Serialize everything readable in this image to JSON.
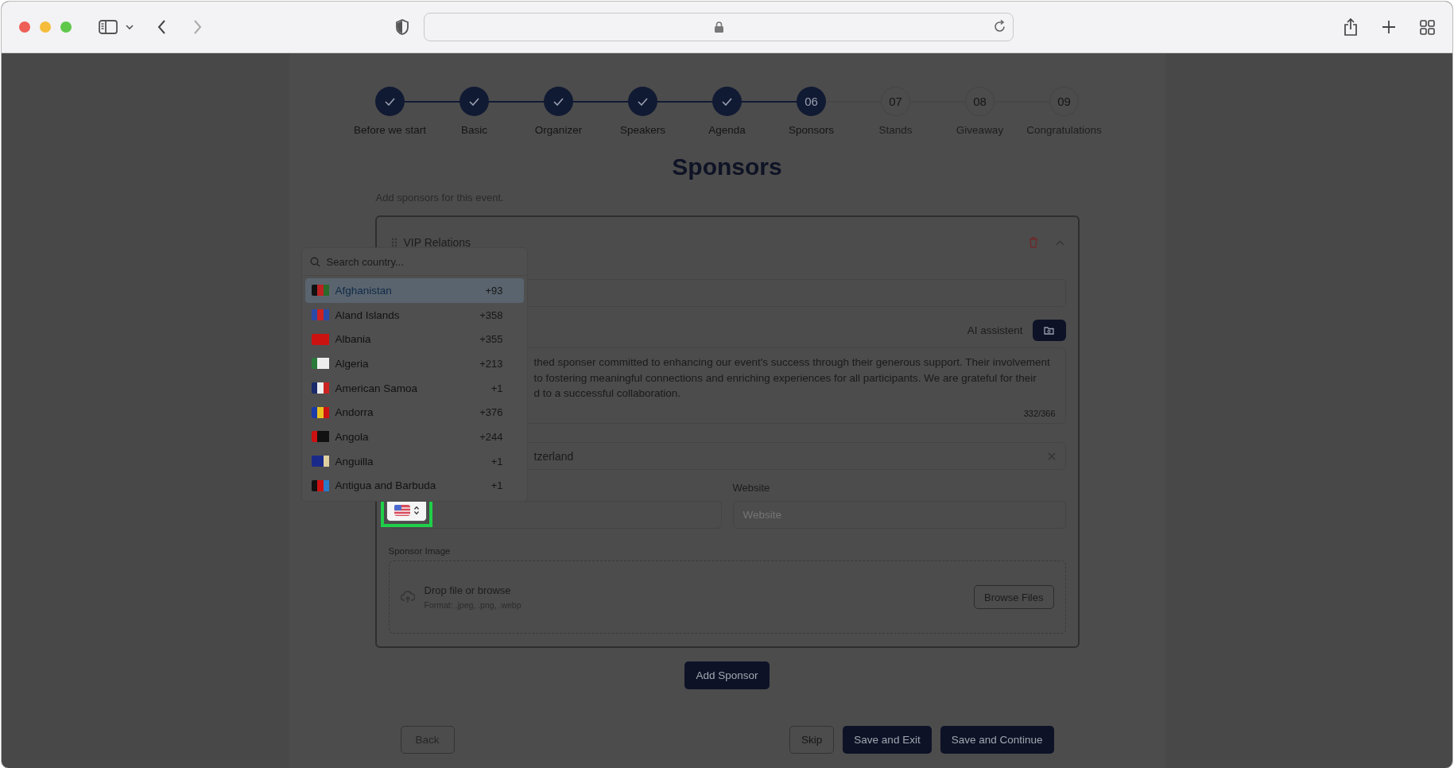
{
  "steps": [
    {
      "label": "Before we start",
      "kind": "done"
    },
    {
      "label": "Basic",
      "kind": "done"
    },
    {
      "label": "Organizer",
      "kind": "done"
    },
    {
      "label": "Speakers",
      "kind": "done"
    },
    {
      "label": "Agenda",
      "kind": "done"
    },
    {
      "label": "Sponsors",
      "number": "06",
      "kind": "current"
    },
    {
      "label": "Stands",
      "number": "07",
      "kind": "upcoming"
    },
    {
      "label": "Giveaway",
      "number": "08",
      "kind": "upcoming"
    },
    {
      "label": "Congratulations",
      "number": "09",
      "kind": "upcoming"
    }
  ],
  "title": "Sponsors",
  "subtitle": "Add sponsors for this event.",
  "sponsor_card": {
    "title": "VIP Relations",
    "ai_label": "AI assistent",
    "description": "thed sponser committed to enhancing our event's success through their generous support. Their involvement\nto fostering meaningful connections and enriching experiences for all participants. We are grateful for their\nd to a successful collaboration.",
    "char_count": "332/366",
    "country_value": "tzerland",
    "website_label": "Website",
    "website_placeholder": "Website",
    "image_label": "Sponsor Image",
    "drop_title": "Drop file or browse",
    "drop_formats": "Format: .jpeg, .png, .webp",
    "browse_button": "Browse Files"
  },
  "country_dropdown": {
    "placeholder": "Search country...",
    "items": [
      {
        "name": "Afghanistan",
        "code": "+93",
        "selected": true
      },
      {
        "name": "Aland Islands",
        "code": "+358",
        "selected": false
      },
      {
        "name": "Albania",
        "code": "+355",
        "selected": false
      },
      {
        "name": "Algeria",
        "code": "+213",
        "selected": false
      },
      {
        "name": "American Samoa",
        "code": "+1",
        "selected": false
      },
      {
        "name": "Andorra",
        "code": "+376",
        "selected": false
      },
      {
        "name": "Angola",
        "code": "+244",
        "selected": false
      },
      {
        "name": "Anguilla",
        "code": "+1",
        "selected": false
      },
      {
        "name": "Antigua and Barbuda",
        "code": "+1",
        "selected": false
      }
    ]
  },
  "add_button": "Add Sponsor",
  "footer": {
    "back": "Back",
    "skip": "Skip",
    "save_exit": "Save and Exit",
    "save_continue": "Save and Continue"
  }
}
